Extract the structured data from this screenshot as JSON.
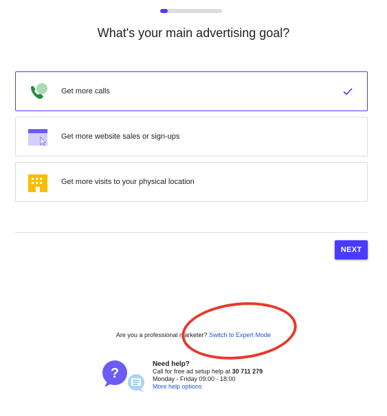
{
  "progress": {
    "fraction": 0.12
  },
  "title": "What's your main advertising goal?",
  "options": [
    {
      "label": "Get more calls",
      "icon": "phone-call-icon",
      "selected": true
    },
    {
      "label": "Get more website sales or sign-ups",
      "icon": "website-cursor-icon",
      "selected": false
    },
    {
      "label": "Get more visits to your physical location",
      "icon": "building-icon",
      "selected": false
    }
  ],
  "next_label": "NEXT",
  "professional": {
    "question": "Are you a professional marketer?",
    "link": "Switch to Expert Mode"
  },
  "help": {
    "heading": "Need help?",
    "call_text": "Call for free ad setup help at",
    "phone": "30 711 279",
    "hours": "Monday - Friday 09:00 - 18:00",
    "more_link": "More help options"
  },
  "colors": {
    "accent": "#4a3aff",
    "link": "#1a56d6",
    "annotation": "#e8392b"
  }
}
